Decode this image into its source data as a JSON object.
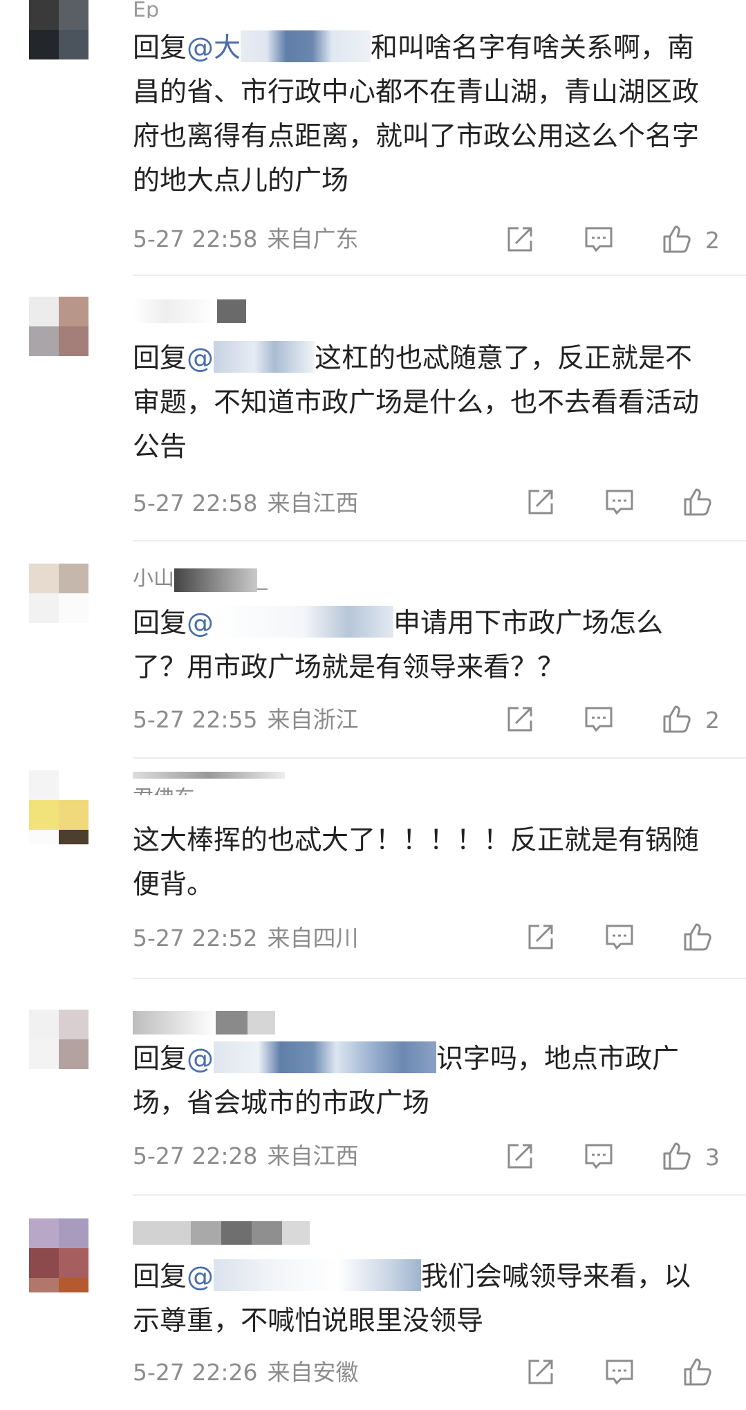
{
  "comments": [
    {
      "name": "Ep",
      "reply_prefix": "回复",
      "mention": "@大",
      "text": "和叫啥名字有啥关系啊，南昌的省、市行政中心都不在青山湖，青山湖区政府也离得有点距离，就叫了市政公用这么个名字的地大点儿的广场",
      "date": "5-27 22:58",
      "location": "来自广东",
      "likes": "2"
    },
    {
      "name": "",
      "reply_prefix": "回复",
      "mention": "@",
      "text": "这杠的也忒随意了，反正就是不审题，不知道市政广场是什么，也不去看看活动公告",
      "date": "5-27 22:58",
      "location": "来自江西",
      "likes": ""
    },
    {
      "name": "小山",
      "reply_prefix": "回复",
      "mention": "@",
      "text": "申请用下市政广场怎么了？用市政广场就是有领导来看？？",
      "date": "5-27 22:55",
      "location": "来自浙江",
      "likes": "2"
    },
    {
      "name": "君佛东",
      "reply_prefix": "",
      "mention": "",
      "text": "这大棒挥的也忒大了！！！！！反正就是有锅随便背。",
      "date": "5-27 22:52",
      "location": "来自四川",
      "likes": ""
    },
    {
      "name": "",
      "reply_prefix": "回复",
      "mention": "@",
      "text": "识字吗，地点市政广场，省会城市的市政广场",
      "date": "5-27 22:28",
      "location": "来自江西",
      "likes": "3"
    },
    {
      "name": "",
      "reply_prefix": "回复",
      "mention": "@",
      "text": "我们会喊领导来看，以示尊重，不喊怕说眼里没领导",
      "date": "5-27 22:26",
      "location": "来自安徽",
      "likes": ""
    }
  ],
  "icons": {
    "share": "share-icon",
    "comment": "comment-icon",
    "like": "like-icon"
  },
  "colors": {
    "text": "#222222",
    "mention": "#4a6ea9",
    "meta": "#8c8c8c",
    "divider": "#ededed"
  }
}
